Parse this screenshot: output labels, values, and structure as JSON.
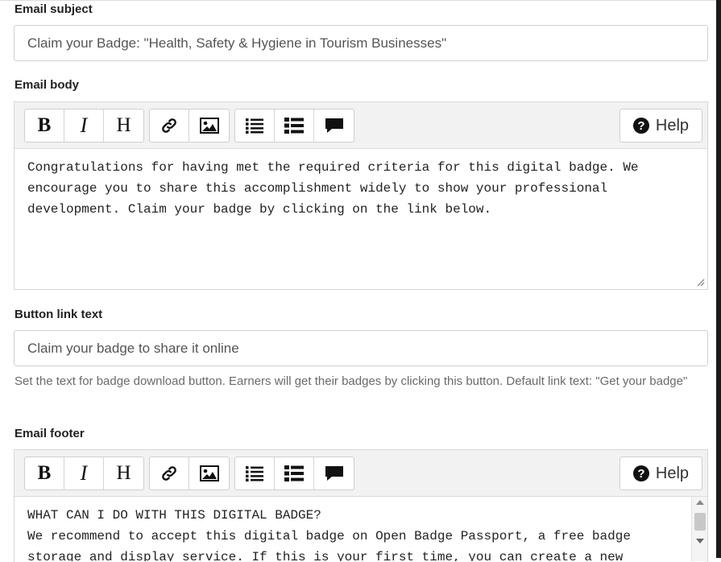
{
  "email_subject": {
    "label": "Email subject",
    "value": "Claim your Badge: \"Health, Safety & Hygiene in Tourism Businesses\""
  },
  "email_body": {
    "label": "Email body",
    "toolbar": {
      "bold": "B",
      "italic": "I",
      "heading": "H",
      "help": "Help"
    },
    "lines": [
      "Congratulations for having met the required criteria for this digital badge. We",
      "encourage you to share this accomplishment widely to show your professional",
      "development. Claim your badge by clicking on the link below."
    ]
  },
  "button_link_text": {
    "label": "Button link text",
    "value": "Claim your badge to share it online",
    "help": "Set the text for badge download button. Earners will get their badges by clicking this button. Default link text: \"Get your badge\""
  },
  "email_footer": {
    "label": "Email footer",
    "toolbar": {
      "bold": "B",
      "italic": "I",
      "heading": "H",
      "help": "Help"
    },
    "lines": [
      "WHAT CAN I DO WITH THIS DIGITAL BADGE?",
      "We recommend to accept this digital badge on Open Badge Passport, a free badge",
      "storage and display service. If this is your first time, you can create a new"
    ]
  },
  "icons": [
    "link-icon",
    "image-icon",
    "unordered-list-icon",
    "ordered-list-icon",
    "quote-icon",
    "question-circle-icon"
  ]
}
